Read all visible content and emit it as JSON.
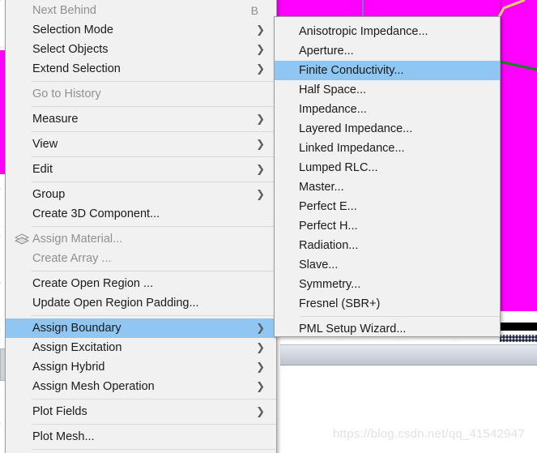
{
  "app": {
    "background_color": "#ff00ff",
    "menu_bg": "#f1f1f1",
    "highlight_color": "#8fc6f2",
    "disabled_color": "#909090"
  },
  "watermark": {
    "text": "https://blog.csdn.net/qq_41542947"
  },
  "context_menu": {
    "name": "modeler-context-menu",
    "items": [
      {
        "label": "Next Behind",
        "accel": "B",
        "disabled": true,
        "submenu": false,
        "icon": null
      },
      {
        "label": "Selection Mode",
        "accel": "",
        "disabled": false,
        "submenu": true,
        "icon": null
      },
      {
        "label": "Select Objects",
        "accel": "",
        "disabled": false,
        "submenu": true,
        "icon": null
      },
      {
        "label": "Extend Selection",
        "accel": "",
        "disabled": false,
        "submenu": true,
        "icon": null
      },
      {
        "separator": true
      },
      {
        "label": "Go to History",
        "accel": "",
        "disabled": true,
        "submenu": false,
        "icon": null
      },
      {
        "separator": true
      },
      {
        "label": "Measure",
        "accel": "",
        "disabled": false,
        "submenu": true,
        "icon": null
      },
      {
        "separator": true
      },
      {
        "label": "View",
        "accel": "",
        "disabled": false,
        "submenu": true,
        "icon": null
      },
      {
        "separator": true
      },
      {
        "label": "Edit",
        "accel": "",
        "disabled": false,
        "submenu": true,
        "icon": null
      },
      {
        "separator": true
      },
      {
        "label": "Group",
        "accel": "",
        "disabled": false,
        "submenu": true,
        "icon": null
      },
      {
        "label": "Create 3D Component...",
        "accel": "",
        "disabled": false,
        "submenu": false,
        "icon": null
      },
      {
        "separator": true
      },
      {
        "label": "Assign Material...",
        "accel": "",
        "disabled": true,
        "submenu": false,
        "icon": "material-layers-icon"
      },
      {
        "label": "Create Array ...",
        "accel": "",
        "disabled": true,
        "submenu": false,
        "icon": null
      },
      {
        "separator": true
      },
      {
        "label": "Create Open Region ...",
        "accel": "",
        "disabled": false,
        "submenu": false,
        "icon": null
      },
      {
        "label": "Update Open Region Padding...",
        "accel": "",
        "disabled": false,
        "submenu": false,
        "icon": null
      },
      {
        "separator": true
      },
      {
        "label": "Assign Boundary",
        "accel": "",
        "disabled": false,
        "submenu": true,
        "selected": true,
        "icon": null
      },
      {
        "label": "Assign Excitation",
        "accel": "",
        "disabled": false,
        "submenu": true,
        "icon": null
      },
      {
        "label": "Assign Hybrid",
        "accel": "",
        "disabled": false,
        "submenu": true,
        "icon": null
      },
      {
        "label": "Assign Mesh Operation",
        "accel": "",
        "disabled": false,
        "submenu": true,
        "icon": null
      },
      {
        "separator": true
      },
      {
        "label": "Plot Fields",
        "accel": "",
        "disabled": false,
        "submenu": true,
        "icon": null
      },
      {
        "separator": true
      },
      {
        "label": "Plot Mesh...",
        "accel": "",
        "disabled": false,
        "submenu": false,
        "icon": null
      },
      {
        "separator": true
      }
    ]
  },
  "boundary_submenu": {
    "name": "assign-boundary-submenu",
    "items": [
      {
        "label": "Anisotropic Impedance...",
        "disabled": false,
        "submenu": false
      },
      {
        "label": "Aperture...",
        "disabled": false,
        "submenu": false
      },
      {
        "label": "Finite Conductivity...",
        "disabled": false,
        "submenu": false,
        "selected": true
      },
      {
        "label": "Half Space...",
        "disabled": false,
        "submenu": false
      },
      {
        "label": "Impedance...",
        "disabled": false,
        "submenu": false
      },
      {
        "label": "Layered Impedance...",
        "disabled": false,
        "submenu": false
      },
      {
        "label": "Linked Impedance...",
        "disabled": false,
        "submenu": false
      },
      {
        "label": "Lumped RLC...",
        "disabled": false,
        "submenu": false
      },
      {
        "label": "Master...",
        "disabled": false,
        "submenu": false
      },
      {
        "label": "Perfect E...",
        "disabled": false,
        "submenu": false
      },
      {
        "label": "Perfect H...",
        "disabled": false,
        "submenu": false
      },
      {
        "label": "Radiation...",
        "disabled": false,
        "submenu": false
      },
      {
        "label": "Slave...",
        "disabled": false,
        "submenu": false
      },
      {
        "label": "Symmetry...",
        "disabled": false,
        "submenu": false
      },
      {
        "label": "Fresnel (SBR+)",
        "disabled": false,
        "submenu": false
      },
      {
        "separator": true
      },
      {
        "label": "PML Setup Wizard...",
        "disabled": false,
        "submenu": false
      }
    ]
  }
}
